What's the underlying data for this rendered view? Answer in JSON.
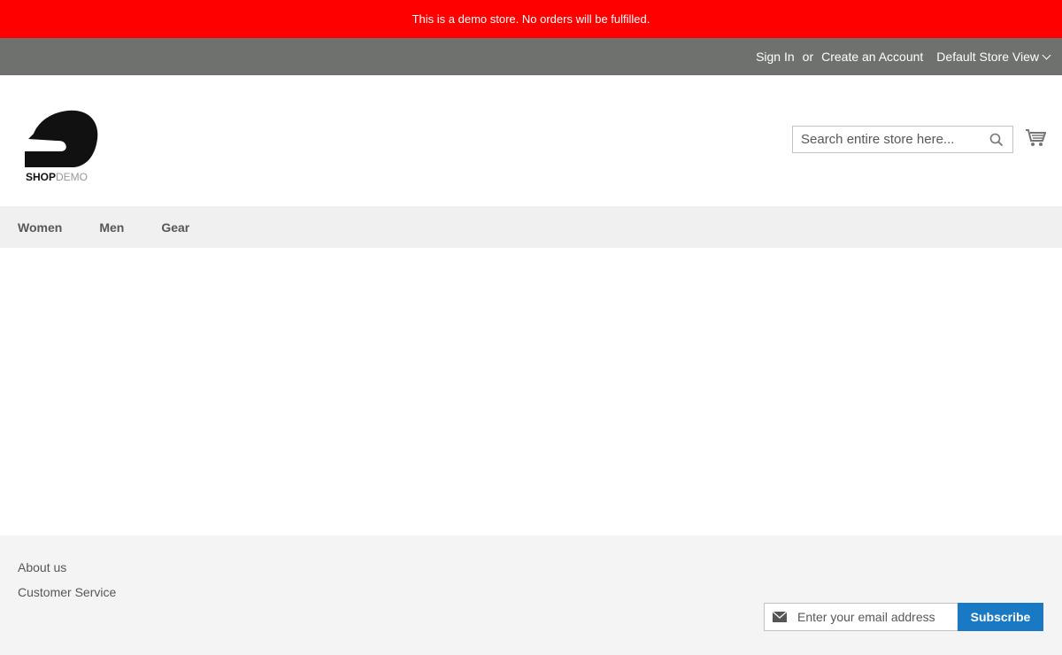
{
  "notice": {
    "text": "This is a demo store. No orders will be fulfilled."
  },
  "top_links": {
    "sign_in": "Sign In",
    "or": "or",
    "create_account": "Create an Account",
    "store_view": "Default Store View"
  },
  "logo": {
    "text_bold": "SHOP",
    "text_light": "DEMO"
  },
  "search": {
    "placeholder": "Search entire store here..."
  },
  "nav": {
    "items": [
      "Women",
      "Men",
      "Gear"
    ]
  },
  "footer": {
    "links": [
      "About us",
      "Customer Service"
    ],
    "newsletter": {
      "placeholder": "Enter your email address",
      "button": "Subscribe"
    }
  },
  "colors": {
    "notice_bg": "#ff0000",
    "top_bar_bg": "#6e716e",
    "nav_bg": "#f0f0f0",
    "footer_bg": "#f4f4f4",
    "accent": "#1979c3"
  },
  "icons": [
    "chevron-down-icon",
    "search-icon",
    "cart-icon",
    "envelope-icon"
  ]
}
